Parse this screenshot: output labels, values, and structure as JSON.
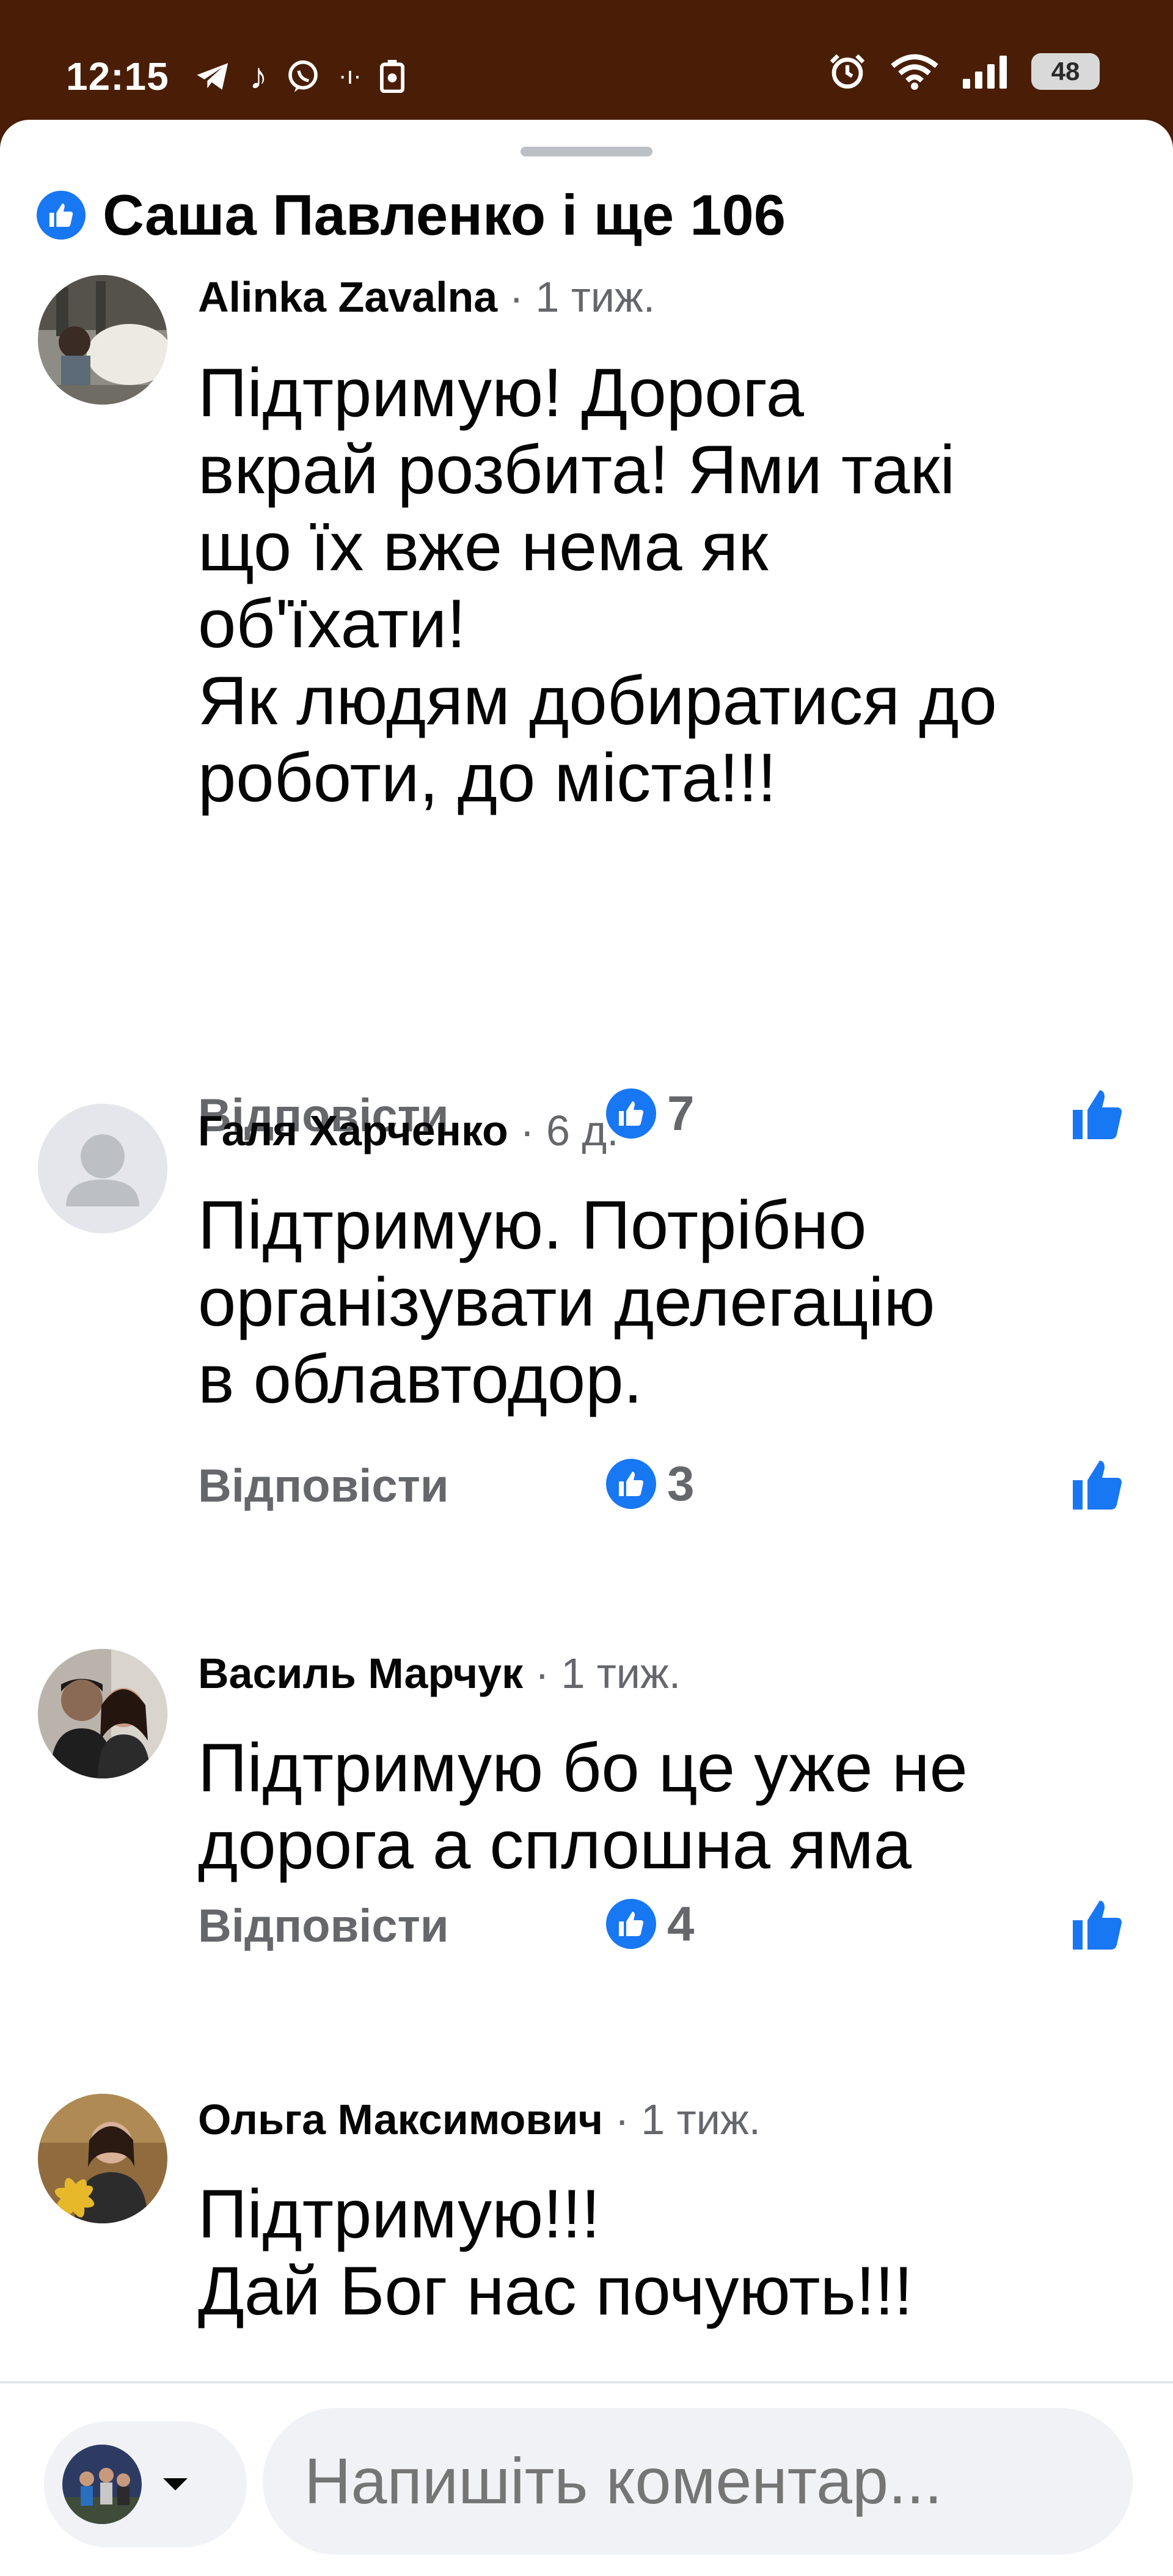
{
  "status_bar": {
    "time": "12:15",
    "battery": "48",
    "left_icons": [
      "telegram-icon",
      "tiktok-icon",
      "viber-icon",
      "wifi-call-icon",
      "screenshot-icon"
    ],
    "right_icons": [
      "alarm-icon",
      "wifi-icon",
      "signal-icon",
      "battery-icon"
    ]
  },
  "header": {
    "title": "Саша Павленко і ще 106",
    "icon": "like-icon",
    "accent_color": "#1877f2"
  },
  "comments": [
    {
      "author": "Alinka Zavalna",
      "time": "· 1 тиж.",
      "lines": [
        "Підтримую! Дорога",
        "вкрай розбита! Ями такі",
        "що їх вже нема як",
        "об'їхати!",
        "Як людям добиратися до",
        "роботи, до міста!!!"
      ],
      "reply_label": "Відповісти",
      "likes": "7"
    },
    {
      "author": "Галя Харченко",
      "time": "· 6 д.",
      "lines": [
        "Підтримую. Потрібно",
        "організувати делегацію",
        "в облавтодор."
      ],
      "reply_label": "Відповісти",
      "likes": "3"
    },
    {
      "author": "Василь Марчук",
      "time": "· 1 тиж.",
      "lines": [
        "Підтримую бо це уже не",
        "дорога а сплошна яма"
      ],
      "reply_label": "Відповісти",
      "likes": "4"
    },
    {
      "author": "Ольга Максимович",
      "time": "· 1 тиж.",
      "lines": [
        "Підтримую!!!",
        "Дай Бог нас почують!!!"
      ]
    }
  ],
  "composer": {
    "placeholder": "Напишіть коментар..."
  }
}
